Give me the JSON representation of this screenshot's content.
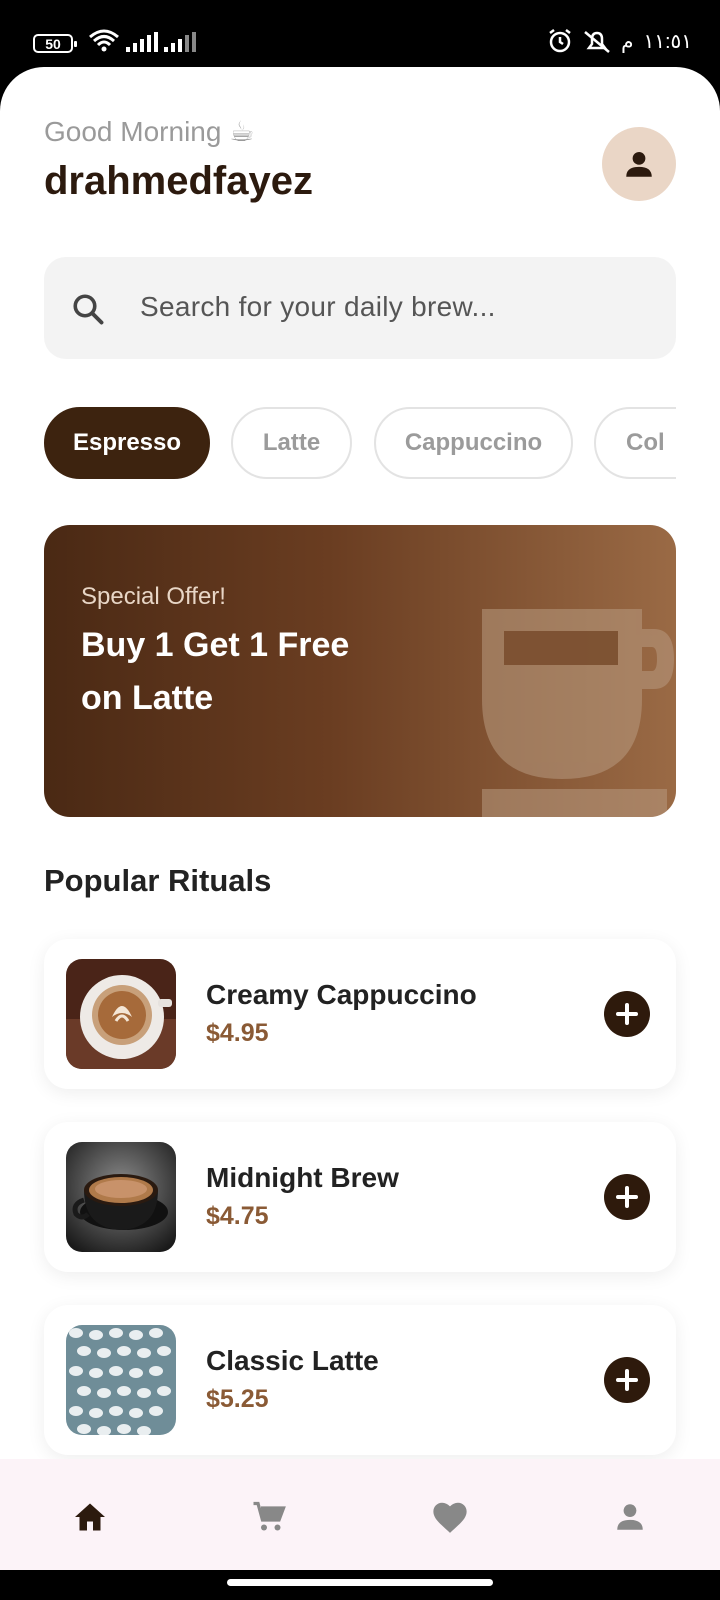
{
  "status_bar": {
    "battery": "50",
    "time": "١١:٥١",
    "ampm": "م"
  },
  "header": {
    "greeting": "Good Morning ☕",
    "username": "drahmedfayez"
  },
  "search": {
    "placeholder": "Search for your daily brew..."
  },
  "categories": [
    "Espresso",
    "Latte",
    "Cappuccino",
    "Col"
  ],
  "offer": {
    "subtitle": "Special Offer!",
    "title": "Buy 1 Get 1 Free\non Latte"
  },
  "section": {
    "title": "Popular Rituals"
  },
  "products": [
    {
      "name": "Creamy Cappuccino",
      "price": "$4.95"
    },
    {
      "name": "Midnight Brew",
      "price": "$4.75"
    },
    {
      "name": "Classic Latte",
      "price": "$5.25"
    }
  ],
  "nav": {
    "items": [
      "home-icon",
      "cart-icon",
      "heart-icon",
      "person-icon"
    ],
    "active": "home-icon"
  },
  "colors": {
    "primary": "#3d230f",
    "price": "#8a5a35",
    "nav_bg": "#fcf3f8"
  }
}
